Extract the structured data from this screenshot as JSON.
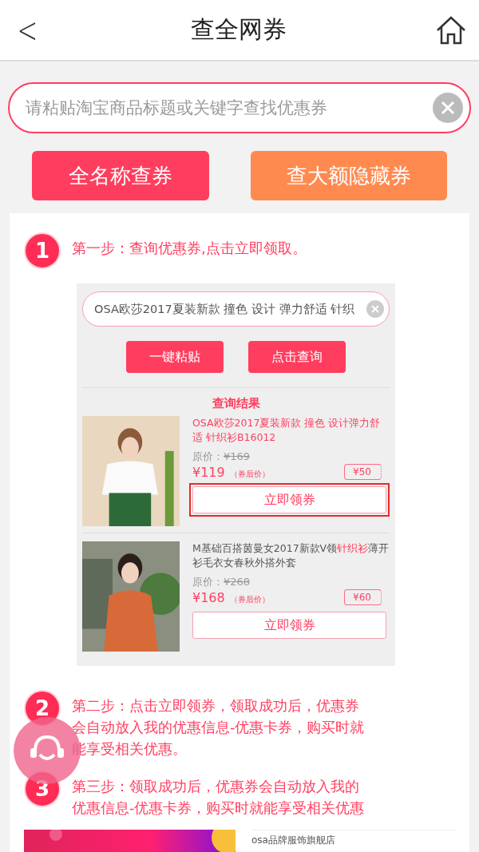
{
  "header": {
    "back": "<",
    "title": "查全网券"
  },
  "search": {
    "placeholder": "请粘贴淘宝商品标题或关键字查找优惠券"
  },
  "buttons": [
    {
      "label": "全名称查券",
      "kind": "primary"
    },
    {
      "label": "查大额隐藏券",
      "kind": "secondary"
    }
  ],
  "steps": [
    {
      "number": "1",
      "text": "第一步：查询优惠券,点击立即领取。"
    }
  ],
  "example": {
    "search_value": "OSA欧莎2017夏装新款 撞色 设计 弹力舒适 针织",
    "buttons": [
      "一键粘贴",
      "点击查询"
    ],
    "results_title": "查询结果",
    "products": [
      {
        "title_parts": [
          {
            "text": "OSA欧莎2017夏装新款 撞色 设计弹力舒适 针织衫B16012",
            "highlight": true
          }
        ],
        "original_label": "原价：",
        "original_price": "¥169",
        "price": "¥119",
        "price_note": "（券后价）",
        "coupon": "¥50",
        "button": "立即领券",
        "highlighted": true
      },
      {
        "title_parts": [
          {
            "text": "M基础百搭茵曼女2017新款V领",
            "highlight": false
          },
          {
            "text": "针织衫",
            "highlight": true
          },
          {
            "text": "薄开衫毛衣女春秋外搭外套",
            "highlight": false
          }
        ],
        "original_label": "原价：",
        "original_price": "¥268",
        "price": "¥168",
        "price_note": "（券后价）",
        "coupon": "¥60",
        "button": "立即领券",
        "highlighted": false
      }
    ]
  },
  "later_steps": [
    {
      "number": "2",
      "text": "第二步：点击立即领券，领取成功后，优惠券会自动放入我的优惠信息-优惠卡券，购买时就能享受相关优惠。"
    },
    {
      "number": "3",
      "text": "第三步：领取成功后，优惠券会自动放入我的优惠信息-优惠卡券，购买时就能享受相关优惠"
    }
  ],
  "shop": {
    "name": "osa品牌服饰旗舰店"
  }
}
